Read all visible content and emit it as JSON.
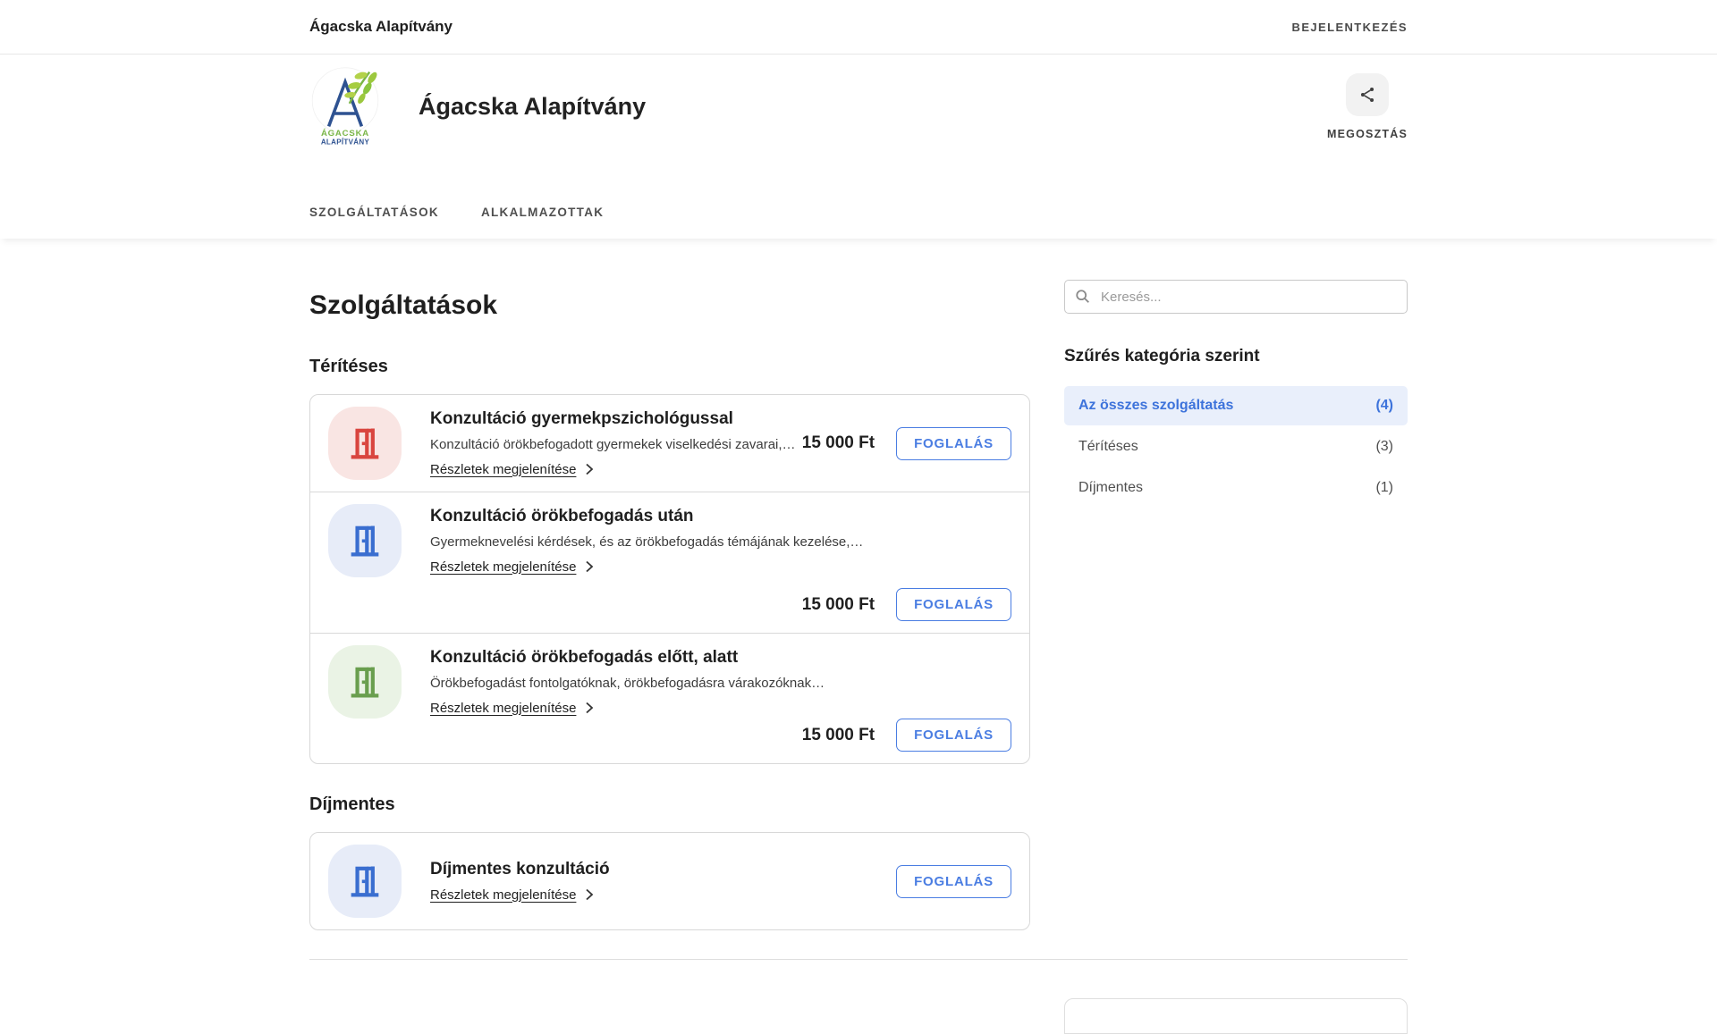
{
  "page": {
    "accent_blue": "#4a7de2",
    "icon_red": "#d9453f",
    "icon_blue": "#3a6ed0",
    "icon_green": "#699e4e"
  },
  "topbar": {
    "brand": "Ágacska Alapítvány",
    "login_label": "BEJELENTKEZÉS"
  },
  "header": {
    "title": "Ágacska Alapítvány",
    "logo_line1": "ÁGACSKA",
    "logo_line2": "ALAPÍTVÁNY",
    "share_label": "MEGOSZTÁS",
    "nav": [
      {
        "label": "SZOLGÁLTATÁSOK"
      },
      {
        "label": "ALKALMAZOTTAK"
      }
    ]
  },
  "main": {
    "page_title": "Szolgáltatások",
    "details_label": "Részletek megjelenítése",
    "book_label": "FOGLALÁS",
    "sections": [
      {
        "heading": "Térítéses",
        "services": [
          {
            "title": "Konzultáció gyermekpszichológussal",
            "description": "Konzultáció örökbefogadott gyermekek viselkedési zavarai,…",
            "price": "15 000 Ft"
          },
          {
            "title": "Konzultáció örökbefogadás után",
            "description": "Gyermeknevelési kérdések, és az örökbefogadás témájának kezelése,…",
            "price": "15 000 Ft"
          },
          {
            "title": "Konzultáció örökbefogadás előtt, alatt",
            "description": "Örökbefogadást fontolgatóknak, örökbefogadásra várakozóknak…",
            "price": "15 000 Ft"
          }
        ]
      },
      {
        "heading": "Díjmentes",
        "services": [
          {
            "title": "Díjmentes konzultáció",
            "description": "",
            "price": ""
          }
        ]
      }
    ]
  },
  "sidebar": {
    "search_placeholder": "Keresés...",
    "filter_heading": "Szűrés kategória szerint",
    "filters": [
      {
        "label": "Az összes szolgáltatás",
        "count": "(4)"
      },
      {
        "label": "Térítéses",
        "count": "(3)"
      },
      {
        "label": "Díjmentes",
        "count": "(1)"
      }
    ]
  },
  "icons": {
    "share": "share-nodes",
    "search": "magnifier",
    "service": "door-open",
    "details": "chevron-right"
  }
}
